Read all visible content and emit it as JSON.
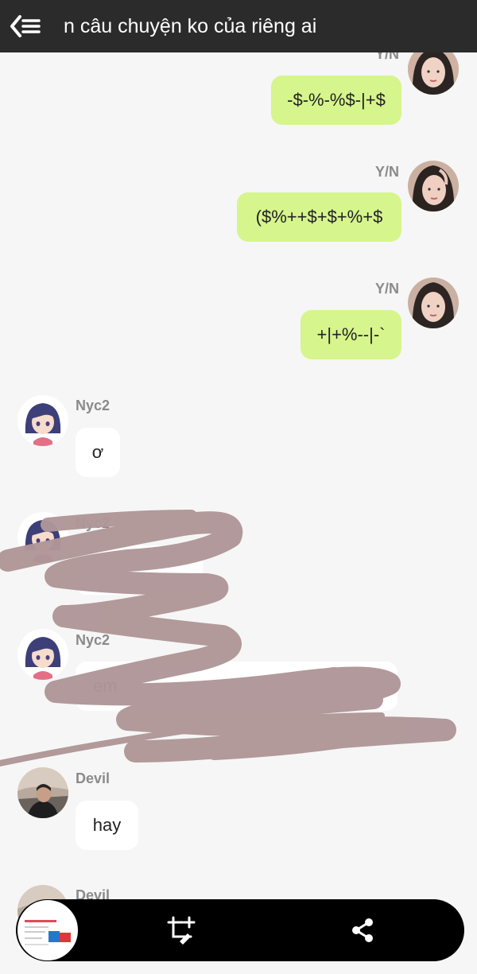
{
  "header": {
    "title": "n câu chuyện ko của riêng ai",
    "back_icon": "back-list-icon"
  },
  "messages": [
    {
      "side": "right",
      "name": "Y/N",
      "text": "-$-%-%$-|+$"
    },
    {
      "side": "right",
      "name": "Y/N",
      "text": "($%++$+$+%+$"
    },
    {
      "side": "right",
      "name": "Y/N",
      "text": "+|+%--|-`"
    },
    {
      "side": "left",
      "name": "Nyc2",
      "text": "ơ"
    },
    {
      "side": "left",
      "name": "Nyc2",
      "text": ""
    },
    {
      "side": "left",
      "name": "Nyc2",
      "text": "em"
    },
    {
      "side": "left",
      "name": "Devil",
      "text": "hay"
    },
    {
      "side": "left",
      "name": "Devil",
      "text": ""
    }
  ],
  "bottom_bar": {
    "crop_icon": "crop-edit-icon",
    "share_icon": "share-icon"
  },
  "colors": {
    "topbar": "#2b2b2b",
    "bubble_right": "#d6f58c",
    "bubble_left": "#ffffff",
    "scribble": "#b09698"
  }
}
